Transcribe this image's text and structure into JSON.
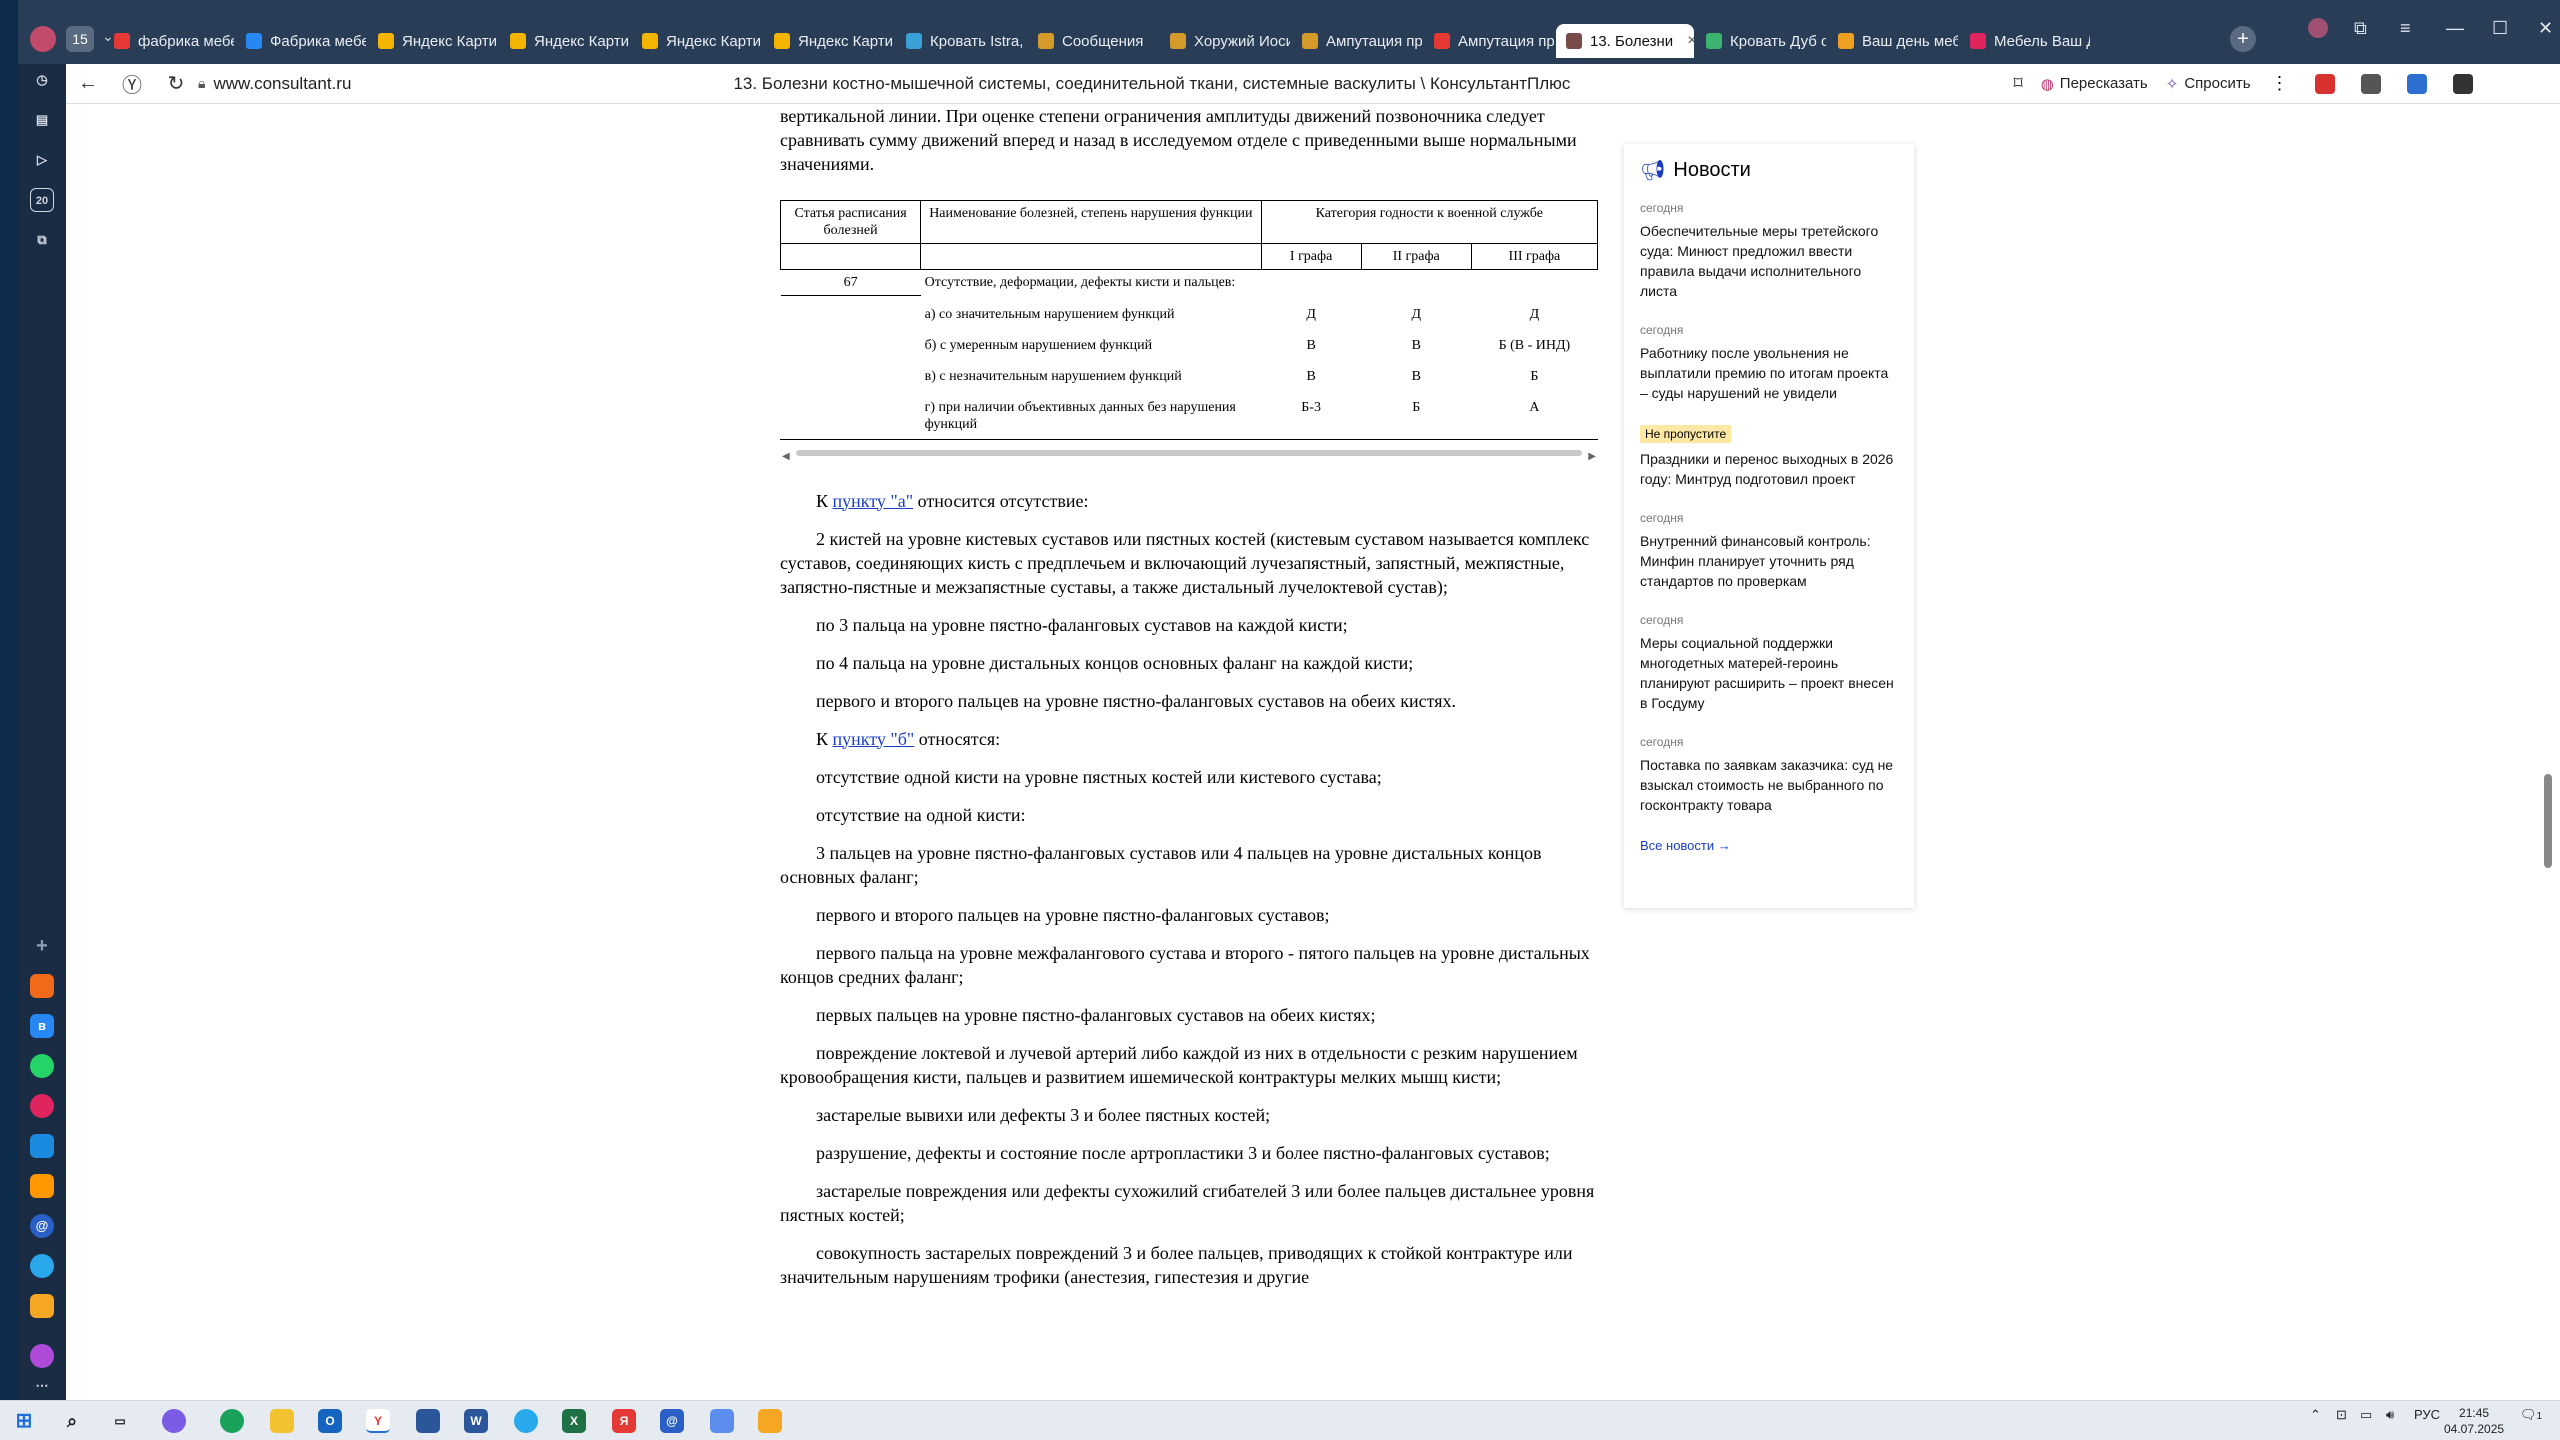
{
  "browser": {
    "tab_count": "15",
    "tabs": [
      {
        "label": "фабрика мебели",
        "icon": "yandex-icon",
        "color": "#e53935"
      },
      {
        "label": "Фабрика мебел",
        "icon": "vk-icon",
        "color": "#2787f5"
      },
      {
        "label": "Яндекс Картин",
        "icon": "images-icon",
        "color": "#f5b400"
      },
      {
        "label": "Яндекс Картин",
        "icon": "images-icon",
        "color": "#f5b400"
      },
      {
        "label": "Яндекс Картин",
        "icon": "images-icon",
        "color": "#f5b400"
      },
      {
        "label": "Яндекс Картин",
        "icon": "images-icon",
        "color": "#f5b400"
      },
      {
        "label": "Кровать Istra, ц",
        "icon": "site-icon",
        "color": "#3aa0d8"
      },
      {
        "label": "Сообщения",
        "icon": "shield-icon",
        "color": "#d49a2a"
      },
      {
        "label": "Хоружий Иоси",
        "icon": "shield-icon",
        "color": "#d49a2a"
      },
      {
        "label": "Ампутация пр",
        "icon": "shield-icon",
        "color": "#d49a2a"
      },
      {
        "label": "Ампутация пр",
        "icon": "yandex-icon",
        "color": "#e53935"
      },
      {
        "label": "13. Болезни",
        "icon": "consultant-icon",
        "color": "#7a4a4a",
        "active": true
      },
      {
        "label": "Кровать Дуб с",
        "icon": "site-icon",
        "color": "#3cb371"
      },
      {
        "label": "Ваш день мебе",
        "icon": "fire-icon",
        "color": "#f0a020"
      },
      {
        "label": "Мебель Ваш Д",
        "icon": "site-icon",
        "color": "#e0245e"
      }
    ],
    "url": "www.consultant.ru",
    "page_title": "13. Болезни костно-мышечной системы, соединительной ткани, системные васкулиты \\ КонсультантПлюс",
    "retell_label": "Пересказать",
    "ask_label": "Спросить"
  },
  "document": {
    "intro": "вертикальной линии. При оценке степени ограничения амплитуды движений позвоночника следует сравнивать сумму движений вперед и назад в исследуемом отделе с приведенными выше нормальными значениями.",
    "table": {
      "col_article": "Статья расписания болезней",
      "col_name": "Наименование болезней, степень нарушения функции",
      "col_category": "Категория годности к военной службе",
      "col_g1": "I графа",
      "col_g2": "II графа",
      "col_g3": "III графа",
      "article": "67",
      "title": "Отсутствие, деформации, дефекты кисти и пальцев:",
      "rows": [
        {
          "name": "а) со значительным нарушением функций",
          "g1": "Д",
          "g2": "Д",
          "g3": "Д"
        },
        {
          "name": "б) с умеренным нарушением функций",
          "g1": "В",
          "g2": "В",
          "g3": "Б (В - ИНД)"
        },
        {
          "name": "в) с незначительным нарушением функций",
          "g1": "В",
          "g2": "В",
          "g3": "Б"
        },
        {
          "name": "г) при наличии объективных данных без нарушения функций",
          "g1": "Б-3",
          "g2": "Б",
          "g3": "А"
        }
      ]
    },
    "p1_pre": "К ",
    "p1_link": "пункту \"а\"",
    "p1_post": " относится отсутствие:",
    "p2": "2 кистей на уровне кистевых суставов или пястных костей (кистевым суставом называется комплекс суставов, соединяющих кисть с предплечьем и включающий лучезапястный, запястный, межпястные, запястно-пястные и межзапястные суставы, а также дистальный лучелоктевой сустав);",
    "p3": "по 3 пальца на уровне пястно-фаланговых суставов на каждой кисти;",
    "p4": "по 4 пальца на уровне дистальных концов основных фаланг на каждой кисти;",
    "p5": "первого и второго пальцев на уровне пястно-фаланговых суставов на обеих кистях.",
    "p6_pre": "К ",
    "p6_link": "пункту \"б\"",
    "p6_post": " относятся:",
    "p7": "отсутствие одной кисти на уровне пястных костей или кистевого сустава;",
    "p8": "отсутствие на одной кисти:",
    "p9": "3 пальцев на уровне пястно-фаланговых суставов или 4 пальцев на уровне дистальных концов основных фаланг;",
    "p10": "первого и второго пальцев на уровне пястно-фаланговых суставов;",
    "p11": "первого пальца на уровне межфалангового сустава и второго - пятого пальцев на уровне дистальных концов средних фаланг;",
    "p12": "первых пальцев на уровне пястно-фаланговых суставов на обеих кистях;",
    "p13": "повреждение локтевой и лучевой артерий либо каждой из них в отдельности с резким нарушением кровообращения кисти, пальцев и развитием ишемической контрактуры мелких мышц кисти;",
    "p14": "застарелые вывихи или дефекты 3 и более пястных костей;",
    "p15": "разрушение, дефекты и состояние после артропластики 3 и более пястно-фаланговых суставов;",
    "p16": "застарелые повреждения или дефекты сухожилий сгибателей 3 или более пальцев дистальнее уровня пястных костей;",
    "p17": "совокупность застарелых повреждений 3 и более пальцев, приводящих к стойкой контрактуре или значительным нарушениям трофики (анестезия, гипестезия и другие"
  },
  "news": {
    "title": "Новости",
    "items": [
      {
        "date": "сегодня",
        "text": "Обеспечительные меры третейского суда: Минюст предложил ввести правила выдачи исполнительного листа"
      },
      {
        "date": "сегодня",
        "text": "Работнику после увольнения не выплатили премию по итогам проекта – суды нарушений не увидели"
      },
      {
        "badge": "Не пропустите",
        "text": "Праздники и перенос выходных в 2026 году: Минтруд подготовил проект"
      },
      {
        "date": "сегодня",
        "text": "Внутренний финансовый контроль: Минфин планирует уточнить ряд стандартов по проверкам"
      },
      {
        "date": "сегодня",
        "text": "Меры социальной поддержки многодетных матерей-героинь планируют расширить – проект внесен в Госдуму"
      },
      {
        "date": "сегодня",
        "text": "Поставка по заявкам заказчика: суд не взыскал стоимость не выбранного по госконтракту товара"
      }
    ],
    "all_label": "Все новости →"
  },
  "taskbar": {
    "lang": "РУС",
    "time": "21:45",
    "date": "04.07.2025",
    "notif_count": "1"
  },
  "colors": {
    "accent": "#1a3ec2",
    "chrome": "#2a3d57",
    "sidebar": "#1a2b44"
  }
}
